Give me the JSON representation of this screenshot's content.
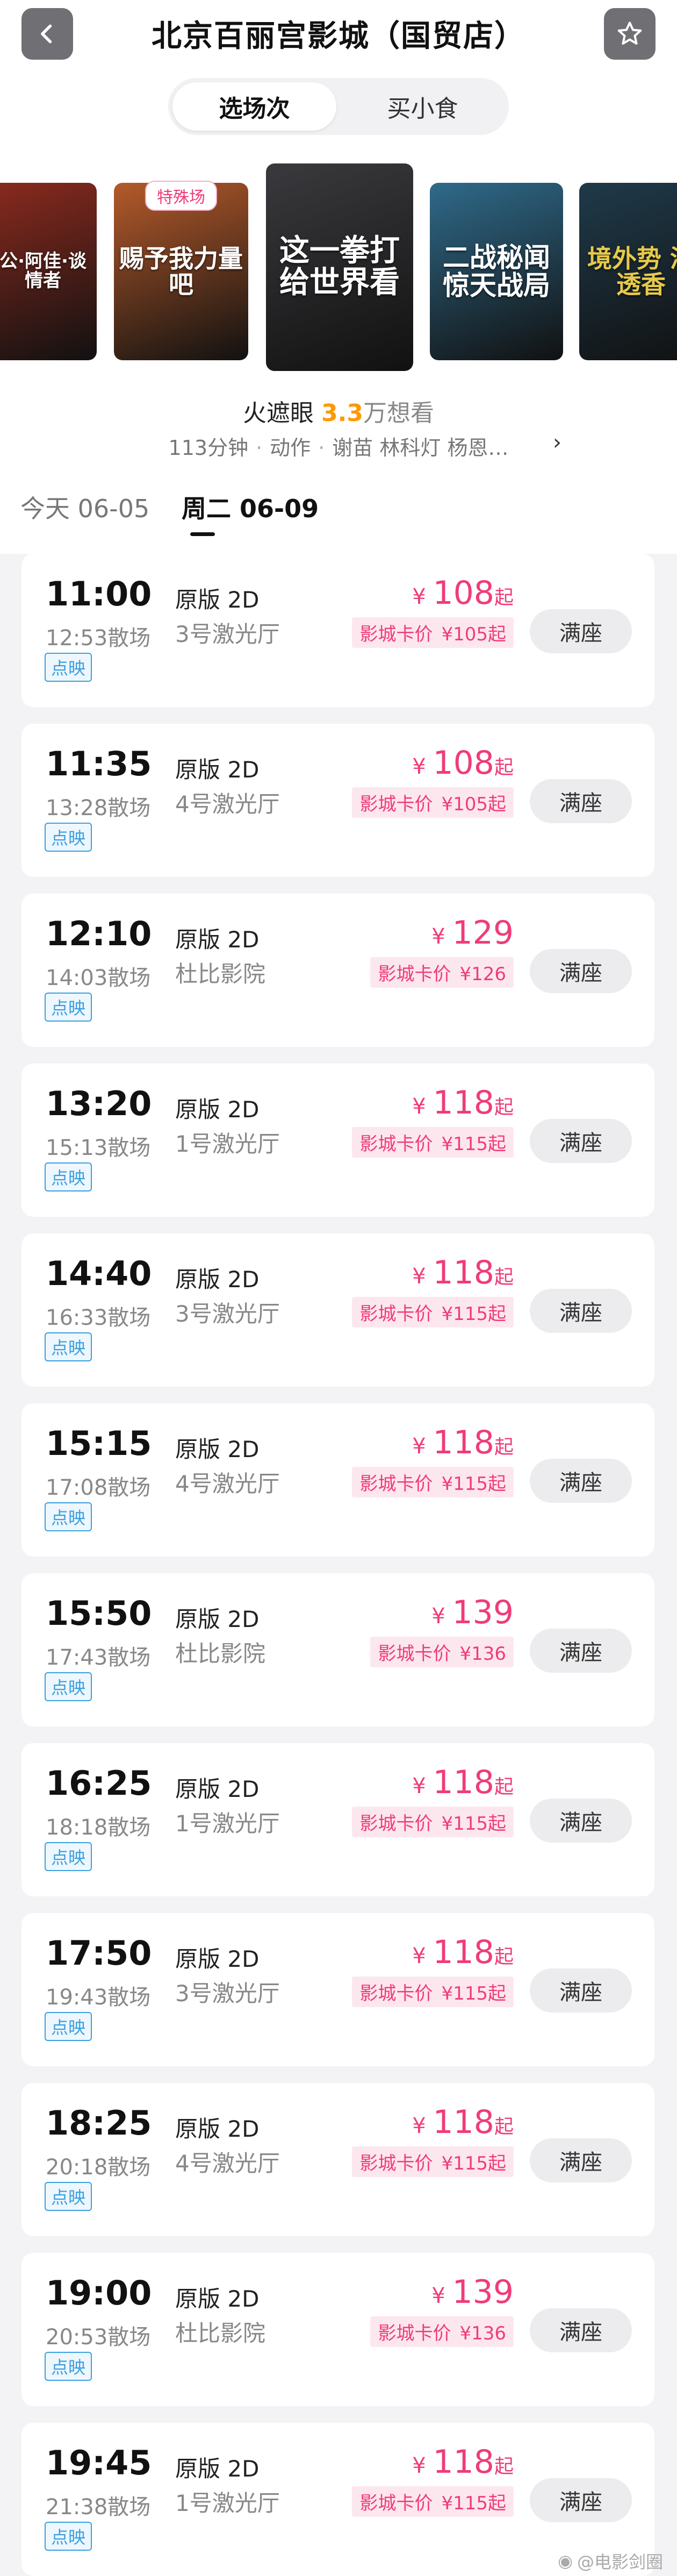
{
  "header": {
    "title": "北京百丽宫影城（国贸店）",
    "tabs": [
      "选场次",
      "买小食"
    ]
  },
  "posters": [
    {
      "text": "公·阿佳·谈情者",
      "badge": "",
      "color": "#8a2a1e"
    },
    {
      "text": "赐予我力量吧",
      "badge": "特殊场",
      "color": "#b45a2a"
    },
    {
      "text": "这一拳打给世界看",
      "badge": "",
      "color": "#3a3a3e"
    },
    {
      "text": "二战秘闻 惊天战局",
      "badge": "",
      "color": "#2f6a8a"
    },
    {
      "text": "境外势 渗透香",
      "badge": "",
      "color": "#1f3a4a"
    }
  ],
  "movie": {
    "name": "火遮眼",
    "score": "3.3",
    "wants": "万想看",
    "duration": "113分钟",
    "genre": "动作",
    "cast": "谢苗  林科灯  杨恩…"
  },
  "dates": {
    "today": "今天 06-05",
    "selected": "周二 06-09"
  },
  "showtimes": [
    {
      "start": "11:00",
      "end": "12:53散场",
      "version": "原版 2D",
      "hall": "3号激光厅",
      "tag": "点映",
      "price": "108",
      "qi": "起",
      "card_label": "影城卡价",
      "card_price": "¥105起",
      "status": "满座"
    },
    {
      "start": "11:35",
      "end": "13:28散场",
      "version": "原版 2D",
      "hall": "4号激光厅",
      "tag": "点映",
      "price": "108",
      "qi": "起",
      "card_label": "影城卡价",
      "card_price": "¥105起",
      "status": "满座"
    },
    {
      "start": "12:10",
      "end": "14:03散场",
      "version": "原版 2D",
      "hall": "杜比影院",
      "tag": "点映",
      "price": "129",
      "qi": "",
      "card_label": "影城卡价",
      "card_price": "¥126",
      "status": "满座"
    },
    {
      "start": "13:20",
      "end": "15:13散场",
      "version": "原版 2D",
      "hall": "1号激光厅",
      "tag": "点映",
      "price": "118",
      "qi": "起",
      "card_label": "影城卡价",
      "card_price": "¥115起",
      "status": "满座"
    },
    {
      "start": "14:40",
      "end": "16:33散场",
      "version": "原版 2D",
      "hall": "3号激光厅",
      "tag": "点映",
      "price": "118",
      "qi": "起",
      "card_label": "影城卡价",
      "card_price": "¥115起",
      "status": "满座"
    },
    {
      "start": "15:15",
      "end": "17:08散场",
      "version": "原版 2D",
      "hall": "4号激光厅",
      "tag": "点映",
      "price": "118",
      "qi": "起",
      "card_label": "影城卡价",
      "card_price": "¥115起",
      "status": "满座"
    },
    {
      "start": "15:50",
      "end": "17:43散场",
      "version": "原版 2D",
      "hall": "杜比影院",
      "tag": "点映",
      "price": "139",
      "qi": "",
      "card_label": "影城卡价",
      "card_price": "¥136",
      "status": "满座"
    },
    {
      "start": "16:25",
      "end": "18:18散场",
      "version": "原版 2D",
      "hall": "1号激光厅",
      "tag": "点映",
      "price": "118",
      "qi": "起",
      "card_label": "影城卡价",
      "card_price": "¥115起",
      "status": "满座"
    },
    {
      "start": "17:50",
      "end": "19:43散场",
      "version": "原版 2D",
      "hall": "3号激光厅",
      "tag": "点映",
      "price": "118",
      "qi": "起",
      "card_label": "影城卡价",
      "card_price": "¥115起",
      "status": "满座"
    },
    {
      "start": "18:25",
      "end": "20:18散场",
      "version": "原版 2D",
      "hall": "4号激光厅",
      "tag": "点映",
      "price": "118",
      "qi": "起",
      "card_label": "影城卡价",
      "card_price": "¥115起",
      "status": "满座"
    },
    {
      "start": "19:00",
      "end": "20:53散场",
      "version": "原版 2D",
      "hall": "杜比影院",
      "tag": "点映",
      "price": "139",
      "qi": "",
      "card_label": "影城卡价",
      "card_price": "¥136",
      "status": "满座"
    },
    {
      "start": "19:45",
      "end": "21:38散场",
      "version": "原版 2D",
      "hall": "1号激光厅",
      "tag": "点映",
      "price": "118",
      "qi": "起",
      "card_label": "影城卡价",
      "card_price": "¥115起",
      "status": "满座"
    }
  ],
  "currency": "¥",
  "watermark": "@电影剑圈",
  "colors": {
    "accent": "#f03c78",
    "tag": "#3aa0e0",
    "score": "#ff9800"
  },
  "icons": {
    "back": "chevron-left-icon",
    "favorite": "star-icon",
    "more": "chevron-right-icon"
  }
}
